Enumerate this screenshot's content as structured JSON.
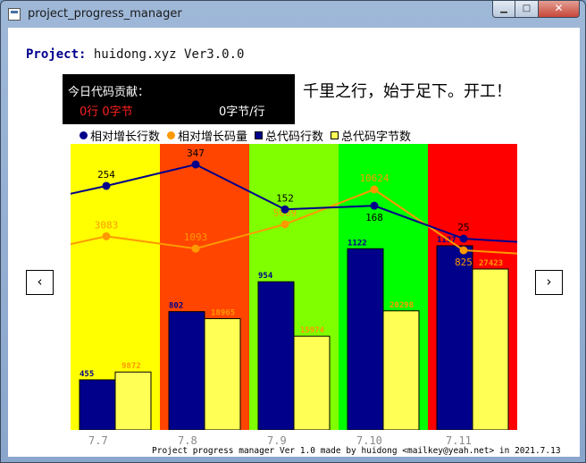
{
  "window": {
    "title": "project_progress_manager",
    "min_glyph": "▁",
    "max_glyph": "□",
    "close_glyph": "✕"
  },
  "project": {
    "label": "Project:",
    "name": "huidong.xyz Ver3.0.0"
  },
  "today": {
    "title": "今日代码贡献：",
    "lines_bytes": "0行 0字节",
    "rate": "0字节/行"
  },
  "motto": "千里之行，始于足下。开工！",
  "legend": [
    {
      "label": "相对增长行数",
      "color": "#00008b",
      "shape": "dot"
    },
    {
      "label": "相对增长码量",
      "color": "#ff9900",
      "shape": "dot"
    },
    {
      "label": "总代码行数",
      "color": "#00008b",
      "shape": "square"
    },
    {
      "label": "总代码字节数",
      "color": "#ffff55",
      "shape": "square"
    }
  ],
  "nav": {
    "prev": "‹",
    "next": "›"
  },
  "footer": "Project progress manager Ver 1.0 made by huidong <mailkey@yeah.net> in 2021.7.13",
  "chart_data": {
    "type": "bar",
    "categories": [
      "7.7",
      "7.8",
      "7.9",
      "7.10",
      "7.11"
    ],
    "band_colors": [
      "#ffff00",
      "#ff4500",
      "#7fff00",
      "#00ff00",
      "#ff0000"
    ],
    "series": [
      {
        "name": "总代码行数",
        "values": [
          455,
          802,
          954,
          1122,
          1137
        ],
        "color": "#00008b"
      },
      {
        "name": "总代码字节数",
        "values": [
          9872,
          18965,
          15974,
          20298,
          27423
        ],
        "color": "#ffff55"
      },
      {
        "name": "相对增长行数",
        "values": [
          254,
          347,
          152,
          168,
          25
        ],
        "color": "#00008b"
      },
      {
        "name": "相对增长码量",
        "values": [
          3083,
          1093,
          5009,
          10624,
          825
        ],
        "color": "#ff9900"
      }
    ]
  }
}
